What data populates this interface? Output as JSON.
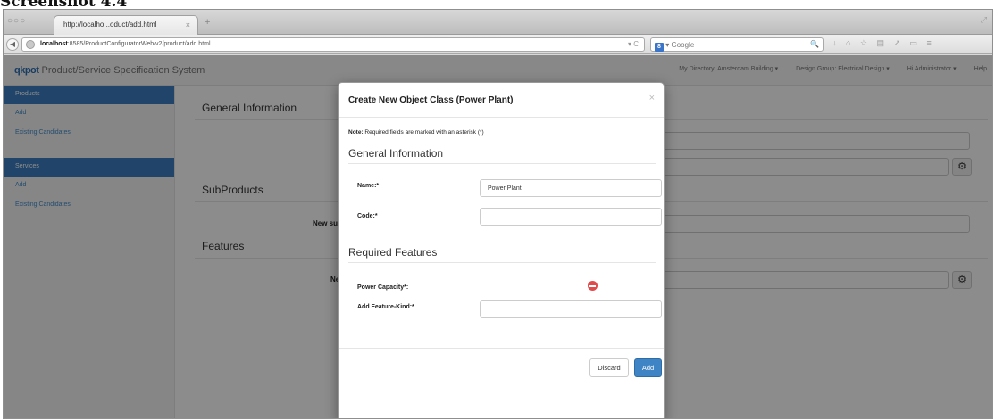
{
  "caption": "Screenshot 4.4",
  "browser": {
    "window_controls": "○○○",
    "tab_title": "http://localho...oduct/add.html",
    "tab_close": "×",
    "new_tab": "+",
    "resize_glyph": "⤢",
    "back_glyph": "◀",
    "url_host": "localhost",
    "url_rest": ":8585/ProductConfiguratorWeb/v2/product/add.html",
    "url_controls": "▾ C",
    "search_engine_glyph": "8",
    "search_placeholder": "▾ Google",
    "search_glyph": "🔍",
    "toolbar_glyphs": "↓ ⌂ ☆ ▤ ↗ ▭ ≡"
  },
  "app": {
    "logo": "qkpot",
    "title": "Product/Service Specification System",
    "menu_directory": "My Directory: Amsterdam Building ▾",
    "menu_design_group": "Design Group: Electrical Design ▾",
    "menu_user": "Hi Administrator ▾",
    "menu_help": "Help"
  },
  "sidebar": {
    "products_header": "Products",
    "products_add": "Add",
    "products_existing": "Existing Candidates",
    "services_header": "Services",
    "services_add": "Add",
    "services_existing": "Existing Candidates"
  },
  "main": {
    "general_information": "General Information",
    "subproducts": "SubProducts",
    "features": "Features",
    "new_subproduct_label": "New su",
    "new_feature_label": "Ne",
    "gear_icon_glyph": "⚙"
  },
  "modal": {
    "title": "Create New Object Class (Power Plant)",
    "close_glyph": "×",
    "note_bold": "Note:",
    "note_text": " Required fields are marked with an asterisk (*)",
    "general_information": "General Information",
    "name_label": "Name:*",
    "name_value": "Power Plant",
    "code_label": "Code:*",
    "code_value": "",
    "required_features": "Required Features",
    "power_capacity_label": "Power Capacity*:",
    "add_feature_kind_label": "Add Feature-Kind:*",
    "add_feature_kind_value": "",
    "discard_label": "Discard",
    "add_label": "Add"
  },
  "colors": {
    "sidebar_active": "#3d7fc1",
    "link": "#428bca",
    "primary_button": "#3f84c4",
    "remove_icon": "#e04a4a"
  }
}
